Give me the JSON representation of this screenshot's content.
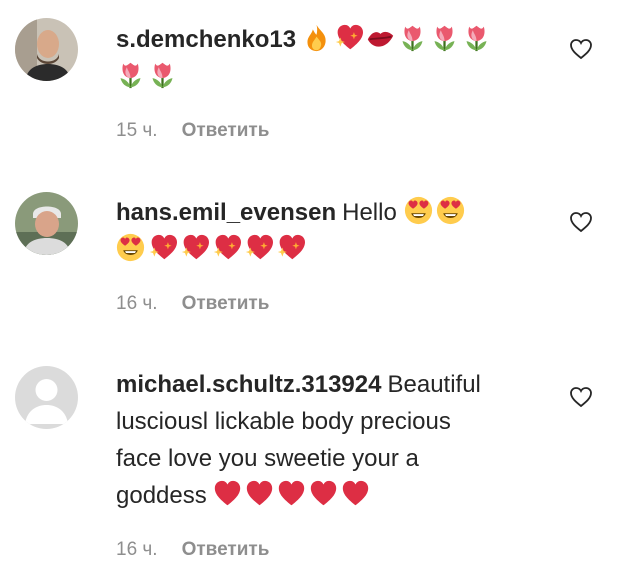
{
  "comments": [
    {
      "username": "s.demchenko13",
      "text": "",
      "emojis_line1": [
        "fire",
        "sparkling-heart",
        "kiss-lips",
        "tulip",
        "tulip",
        "tulip"
      ],
      "emojis_line2": [
        "tulip",
        "tulip"
      ],
      "time": "15 ч.",
      "reply": "Ответить",
      "avatar": "person-bald"
    },
    {
      "username": "hans.emil_evensen",
      "text": "Hello",
      "emojis_line1": [
        "heart-eyes",
        "heart-eyes"
      ],
      "emojis_line2": [
        "heart-eyes",
        "sparkling-heart",
        "sparkling-heart",
        "sparkling-heart",
        "sparkling-heart",
        "sparkling-heart"
      ],
      "time": "16 ч.",
      "reply": "Ответить",
      "avatar": "person-grey-hair"
    },
    {
      "username": "michael.schultz.313924",
      "text_lines": [
        "Beautiful",
        "lusciousl lickable body precious",
        "face love you sweetie your a",
        "goddess"
      ],
      "emojis_line4": [
        "red-heart",
        "red-heart",
        "red-heart",
        "red-heart",
        "red-heart"
      ],
      "time": "16 ч.",
      "reply": "Ответить",
      "avatar": "default-avatar"
    }
  ],
  "colors": {
    "meta": "#8e8e8e",
    "text": "#262626"
  },
  "icons": {
    "like": "heart-outline-icon"
  }
}
